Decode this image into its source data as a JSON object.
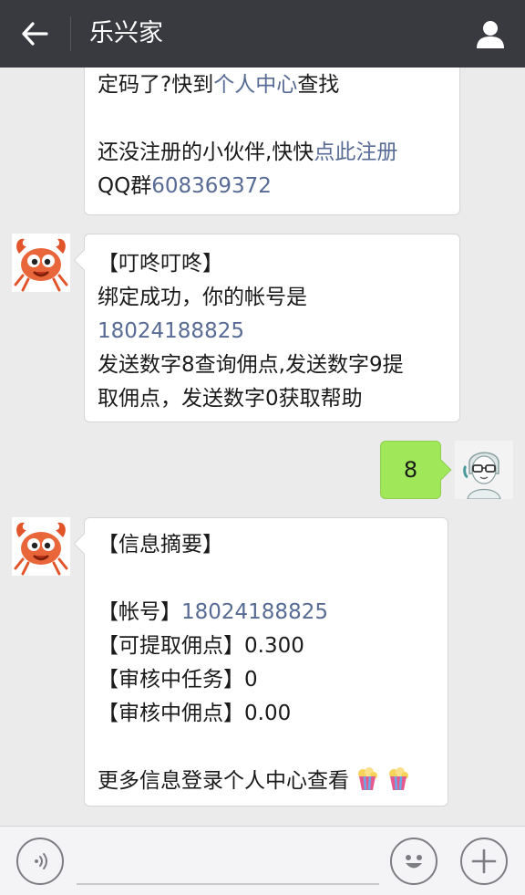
{
  "header": {
    "back_icon": "back-arrow-icon",
    "title": "乐兴家",
    "profile_icon": "person-icon",
    "bg_color": "#393a3f"
  },
  "messages": {
    "m1": {
      "line1_text": "定码了?快到",
      "line1_link": "个人中心",
      "line1_tail": "查找",
      "line2_text": "还没注册的小伙伴,快快",
      "line2_link": "点此注册",
      "line3_text": "QQ群",
      "line3_link": "608369372"
    },
    "m2": {
      "line1": "【叮咚叮咚】",
      "line2": "绑定成功，你的帐号是",
      "line3_link": "18024188825",
      "line4": "发送数字8查询佣点,发送数字9提",
      "line5": "取佣点，发送数字0获取帮助"
    },
    "m3": {
      "text": "8"
    },
    "m4": {
      "line1": "【信息摘要】",
      "line2_label": "【帐号】",
      "line2_link": "18024188825",
      "line3": "【可提取佣点】0.300",
      "line4": "【审核中任务】0",
      "line5": "【审核中佣点】0.00",
      "line6": "更多信息登录个人中心查看"
    }
  },
  "bottom": {
    "voice_icon": "voice-icon",
    "emoji_icon": "emoji-icon",
    "plus_icon": "plus-icon"
  },
  "colors": {
    "link": "#576b95",
    "sent_bubble": "#a0e75a",
    "chat_bg": "#ebebeb"
  }
}
